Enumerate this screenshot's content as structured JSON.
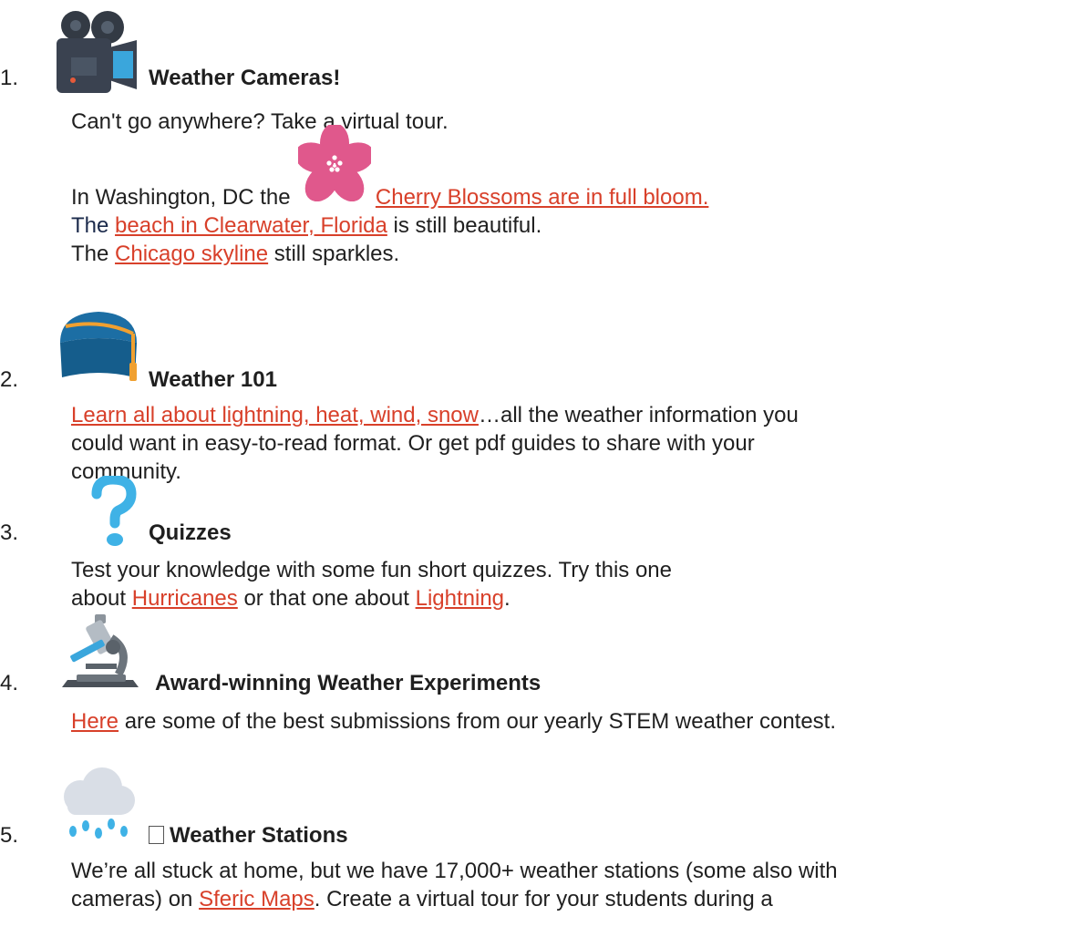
{
  "items": [
    {
      "number": "1.",
      "icon": "video-camera-icon",
      "title": "Weather Cameras!",
      "intro": "Can't go anywhere? Take a virtual tour.",
      "l1_pre": "In Washington, DC the",
      "l1_link": "Cherry Blossoms are in full bloom.",
      "l2_pre": "The",
      "l2_link": "beach in Clearwater, Florida",
      "l2_post": "is still beautiful.",
      "l3_pre": "The",
      "l3_link": "Chicago skyline",
      "l3_post": "still sparkles."
    },
    {
      "number": "2.",
      "icon": "graduation-cap-icon",
      "title": "Weather 101",
      "link": "Learn all about lightning, heat, wind, snow",
      "rest1": "…all the weather information you",
      "rest2": "could want in easy-to-read format. Or get pdf guides to share with your",
      "rest3": "community."
    },
    {
      "number": "3.",
      "icon": "question-mark-icon",
      "title": "Quizzes",
      "text1": "Test your knowledge with some fun short quizzes. Try this one",
      "pre2": "about",
      "link1": "Hurricanes",
      "mid": "or that one about",
      "link2": "Lightning",
      "end": "."
    },
    {
      "number": "4.",
      "icon": "microscope-icon",
      "title": "Award-winning Weather Experiments",
      "link": "Here",
      "rest": "are some of the best submissions from our yearly STEM weather contest."
    },
    {
      "number": "5.",
      "icon": "rain-cloud-icon",
      "title": "Weather Stations",
      "text1": "We’re all stuck at home, but we have 17,000+ weather stations (some also with",
      "pre2": "cameras) on",
      "link": "Sferic Maps",
      "rest2": ". Create a virtual tour for your students during a"
    }
  ],
  "colors": {
    "link": "#d8402a",
    "text": "#1f1f1f"
  }
}
